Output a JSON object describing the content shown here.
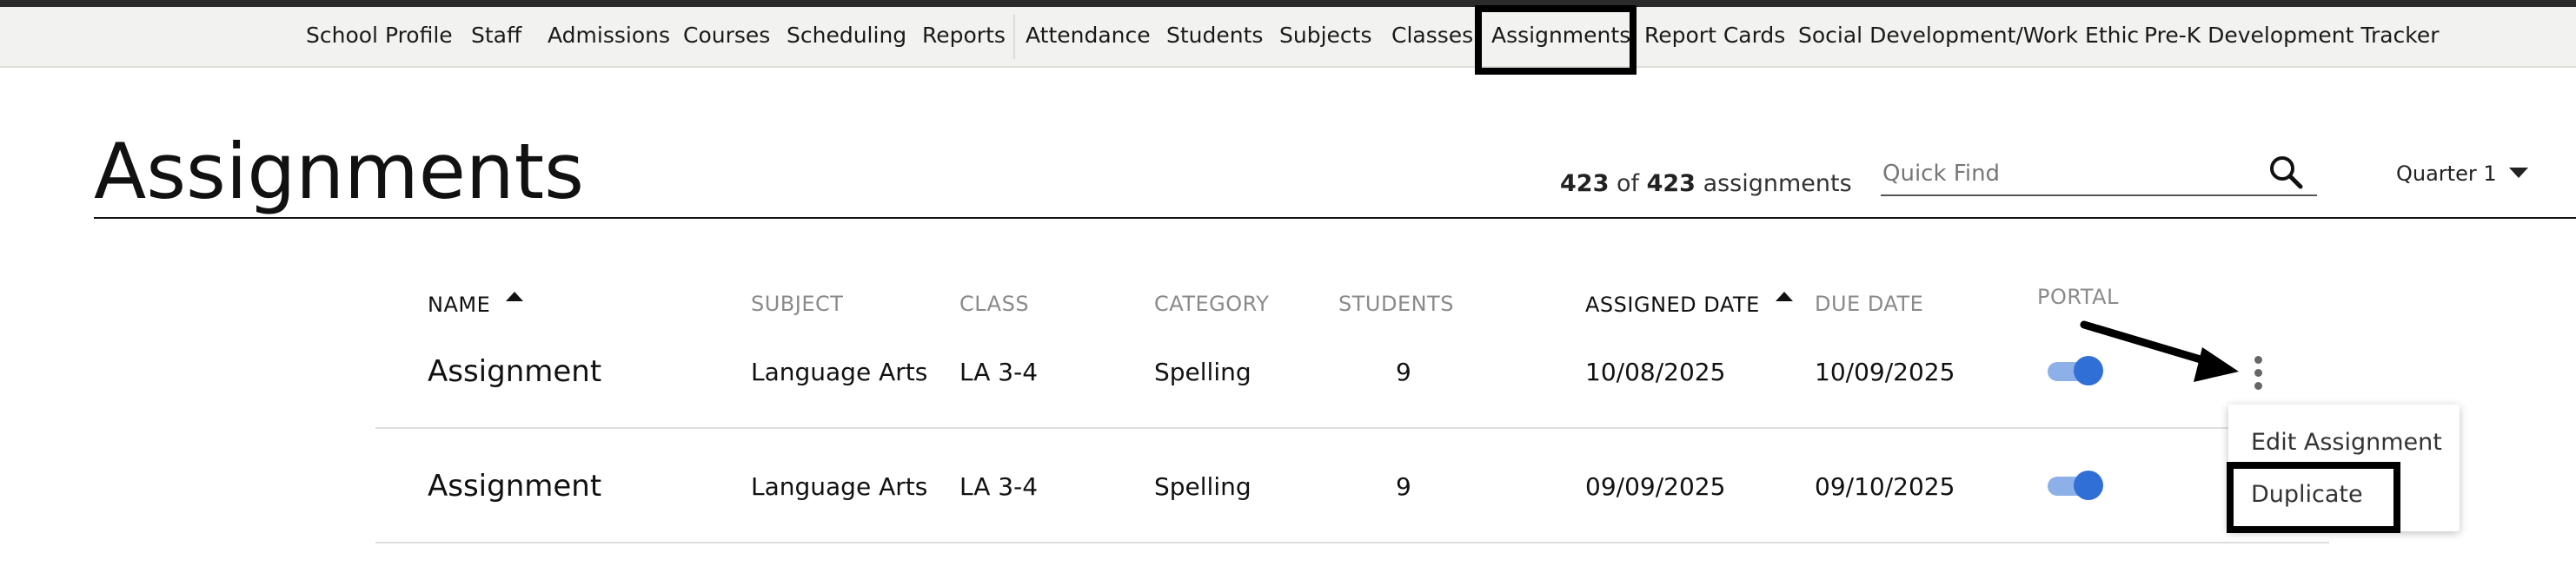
{
  "nav": {
    "items": [
      "School Profile",
      "Staff",
      "Admissions",
      "Courses",
      "Scheduling",
      "Reports",
      "Attendance",
      "Students",
      "Subjects",
      "Classes",
      "Assignments",
      "Report Cards",
      "Social Development/Work Ethic",
      "Pre-K Development Tracker"
    ],
    "active": "Assignments"
  },
  "page": {
    "title": "Assignments"
  },
  "toolbar": {
    "count_shown": "423",
    "count_of": "of",
    "count_total": "423",
    "count_unit": "assignments",
    "search_placeholder": "Quick Find",
    "search_icon": "search-icon",
    "quarter": "Quarter 1"
  },
  "table": {
    "headers": {
      "name": "NAME",
      "subject": "SUBJECT",
      "class": "CLASS",
      "category": "CATEGORY",
      "students": "STUDENTS",
      "assigned_date": "ASSIGNED DATE",
      "due_date": "DUE DATE",
      "portal": "PORTAL"
    },
    "sorted_by": [
      "NAME",
      "ASSIGNED DATE"
    ],
    "rows": [
      {
        "name": "Assignment",
        "subject": "Language Arts",
        "class": "LA 3-4",
        "category": "Spelling",
        "students": "9",
        "assigned_date": "10/08/2025",
        "due_date": "10/09/2025",
        "portal": true
      },
      {
        "name": "Assignment",
        "subject": "Language Arts",
        "class": "LA 3-4",
        "category": "Spelling",
        "students": "9",
        "assigned_date": "09/09/2025",
        "due_date": "09/10/2025",
        "portal": true
      }
    ]
  },
  "row_menu": {
    "items": [
      "Edit Assignment",
      "Duplicate"
    ],
    "highlighted": "Duplicate"
  },
  "colors": {
    "accent_blue": "#2f6fd6",
    "toggle_track": "#8eb0e8",
    "nav_bg": "#f2f2f0",
    "highlight_box": "#000000"
  }
}
